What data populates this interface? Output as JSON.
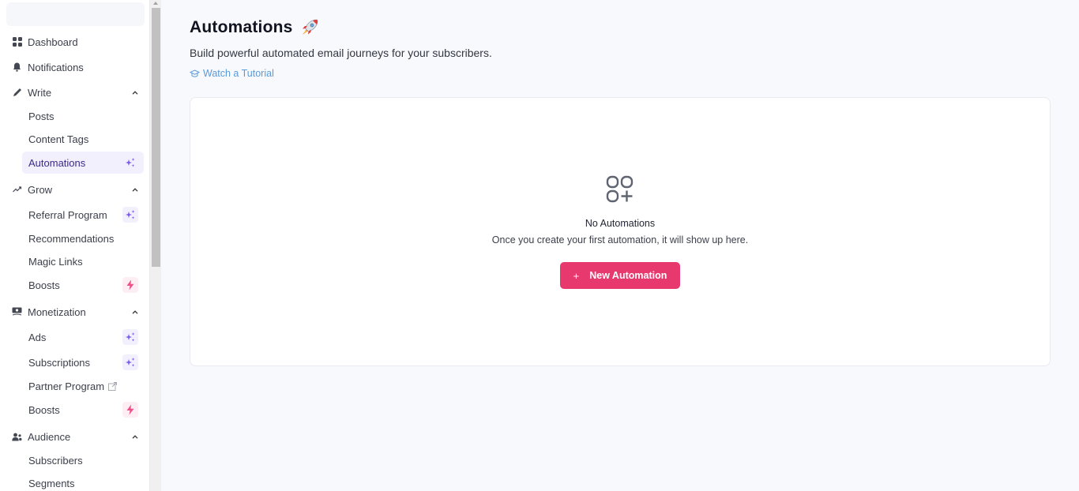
{
  "sidebar": {
    "sections": [
      {
        "label": "Dashboard",
        "icon": "dashboard-grid-icon"
      },
      {
        "label": "Notifications",
        "icon": "bell-icon"
      },
      {
        "label": "Write",
        "icon": "pencil-icon",
        "expanded": true,
        "items": [
          {
            "label": "Posts"
          },
          {
            "label": "Content Tags"
          },
          {
            "label": "Automations",
            "active": true,
            "badge": "sparkles"
          }
        ]
      },
      {
        "label": "Grow",
        "icon": "trend-up-icon",
        "expanded": true,
        "items": [
          {
            "label": "Referral Program",
            "badge": "sparkles"
          },
          {
            "label": "Recommendations"
          },
          {
            "label": "Magic Links"
          },
          {
            "label": "Boosts",
            "badge": "lightning"
          }
        ]
      },
      {
        "label": "Monetization",
        "icon": "money-icon",
        "expanded": true,
        "items": [
          {
            "label": "Ads",
            "badge": "sparkles"
          },
          {
            "label": "Subscriptions",
            "badge": "sparkles"
          },
          {
            "label": "Partner Program",
            "external": true
          },
          {
            "label": "Boosts",
            "badge": "lightning"
          }
        ]
      },
      {
        "label": "Audience",
        "icon": "users-icon",
        "expanded": true,
        "items": [
          {
            "label": "Subscribers"
          },
          {
            "label": "Segments"
          }
        ]
      }
    ]
  },
  "page": {
    "title": "Automations",
    "title_emoji": "rocket",
    "subtitle": "Build powerful automated email journeys for your subscribers.",
    "tutorial_link": "Watch a Tutorial"
  },
  "empty_state": {
    "title": "No Automations",
    "description": "Once you create your first automation, it will show up here.",
    "button_plus": "+",
    "button_label": "New Automation"
  },
  "colors": {
    "accent_pink": "#e8396f",
    "active_purple": "#7c5ce6",
    "link_blue": "#5a9ad9",
    "boost_pink": "#f0508a"
  }
}
